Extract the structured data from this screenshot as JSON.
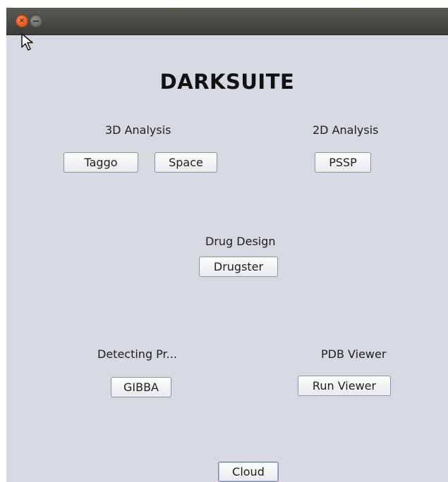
{
  "window": {
    "close_glyph": "×",
    "title": "DARKSUITE"
  },
  "sections": {
    "analysis_3d": {
      "label": "3D Analysis",
      "buttons": [
        "Taggo",
        "Space"
      ]
    },
    "analysis_2d": {
      "label": "2D Analysis",
      "buttons": [
        "PSSP"
      ]
    },
    "drug_design": {
      "label": "Drug Design",
      "buttons": [
        "Drugster"
      ]
    },
    "detecting": {
      "label": "Detecting Pr...",
      "buttons": [
        "GIBBA"
      ]
    },
    "pdb_viewer": {
      "label": "PDB Viewer",
      "buttons": [
        "Run Viewer"
      ]
    },
    "cloud": {
      "buttons": [
        "Cloud"
      ]
    }
  },
  "icons": {
    "close": "close-icon",
    "minimize": "minimize-icon",
    "cursor": "mouse-pointer-icon"
  }
}
